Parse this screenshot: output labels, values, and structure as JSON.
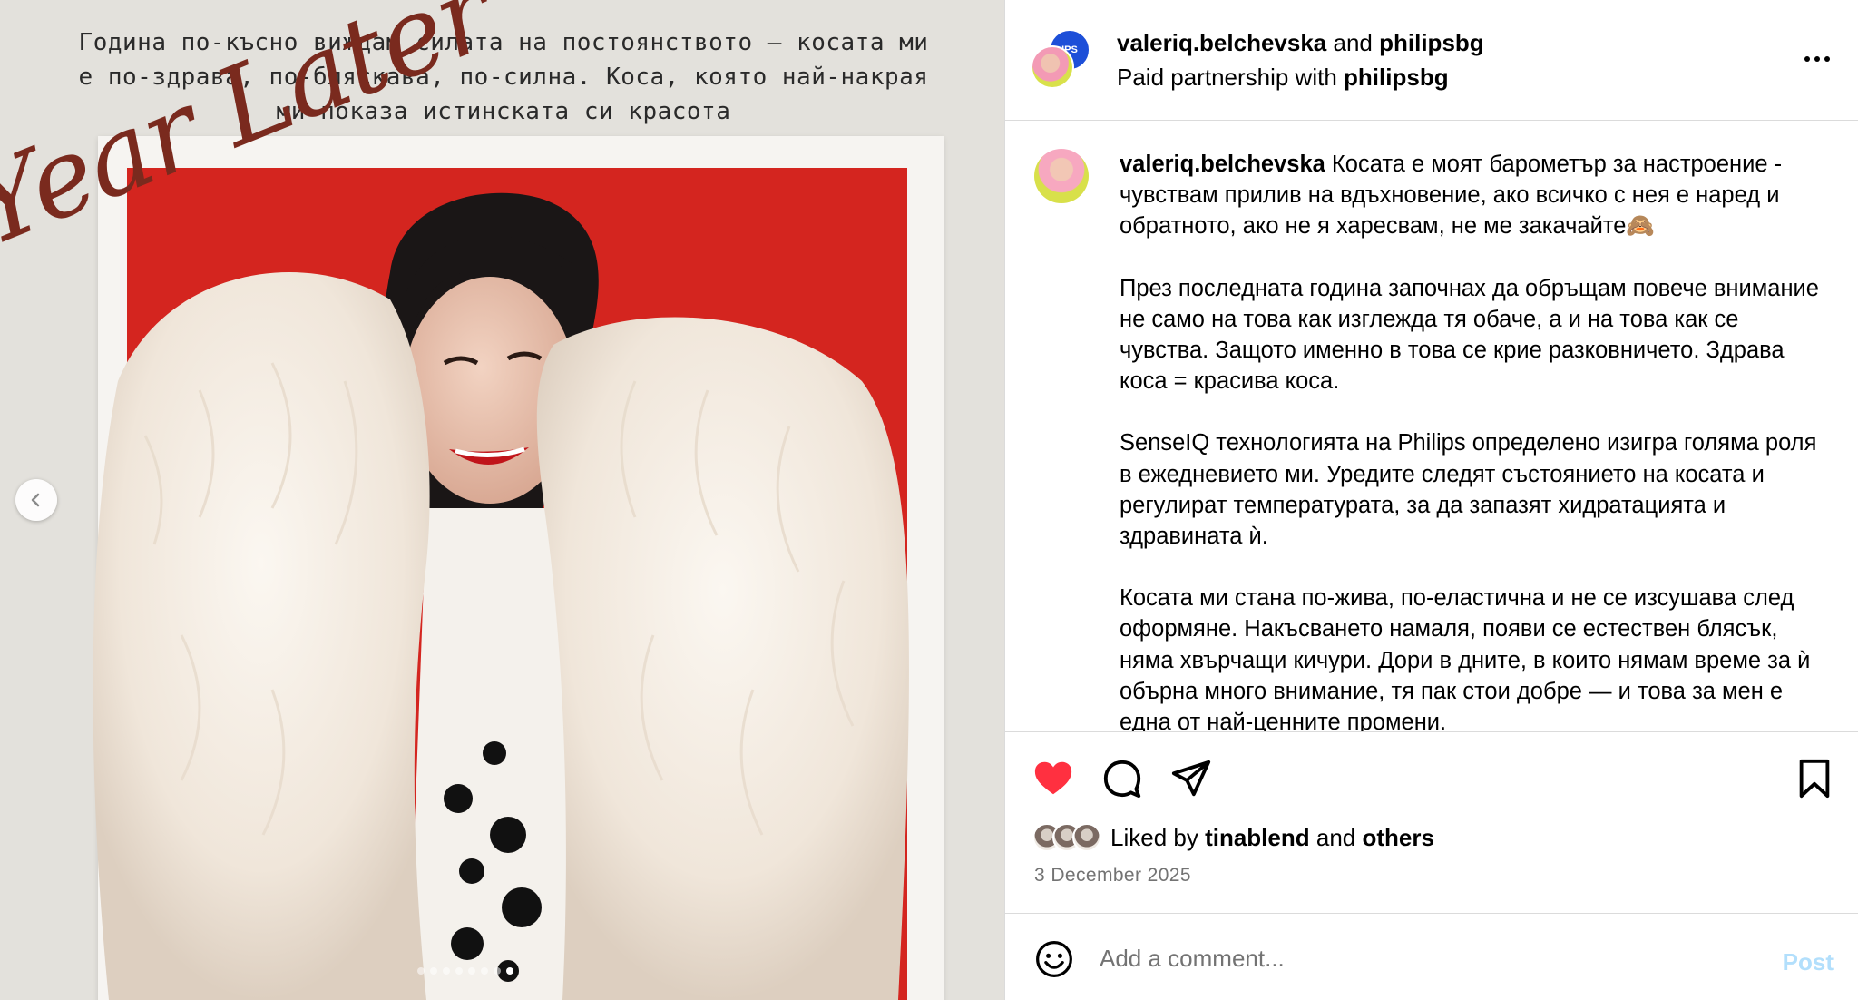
{
  "media": {
    "caption_lines": [
      "Година по-късно виждам силата на постоянството – косата ми",
      "е по-здрава, по-бляскава, по-силна. Коса, която най-накрая",
      "ми показа истинската си красота"
    ],
    "script_title": "Year Later",
    "slide_count": 8,
    "active_slide_index": 7
  },
  "header": {
    "author": "valeriq.belchevska",
    "and_word": "and",
    "partner": "philipsbg",
    "partnership_prefix": "Paid partnership with",
    "partner_badge": "IPS"
  },
  "post": {
    "author": "valeriq.belchevska",
    "paragraphs": [
      "Косата е моят барометър за настроение - чувствам прилив на вдъхновение, ако всичко с нея е наред и обратното, ако не я харесвам, не ме закачайте🙈",
      "През последната година започнах да обръщам повече внимание не само на това как изглежда тя обаче, а и на това как се чувства. Защото именно в това се крие разковничето. Здрава коса = красива коса.",
      "SenseIQ технологията на Philips определено изигра голяма роля в ежедневието ми. Уредите следят състоянието на косата и регулират температурата, за да запазят хидратацията и здравината ѝ.",
      "Косата ми стана по-жива, по-еластична и не се изсушава след оформяне. Накъсването намаля, появи се естествен блясък, няма хвърчащи кичури. Дори в дните, в които нямам време за ѝ обърна много внимание, тя пак стои добре — и това за мен е една от най-ценните промени."
    ]
  },
  "likes": {
    "prefix": "Liked by",
    "user": "tinablend",
    "and_word": "and",
    "others": "others"
  },
  "date": "3 December 2025",
  "comment": {
    "placeholder": "Add a comment...",
    "post_label": "Post"
  },
  "colors": {
    "like_red": "#ff3040",
    "post_blue_disabled": "#b2dffc",
    "backdrop_red": "#d4251f"
  },
  "icons": {
    "like": "heart-filled-icon",
    "comment": "speech-bubble-icon",
    "share": "paper-plane-icon",
    "save": "bookmark-icon",
    "more": "more-horizontal-icon",
    "prev": "chevron-left-icon",
    "emoji": "smiley-icon"
  }
}
